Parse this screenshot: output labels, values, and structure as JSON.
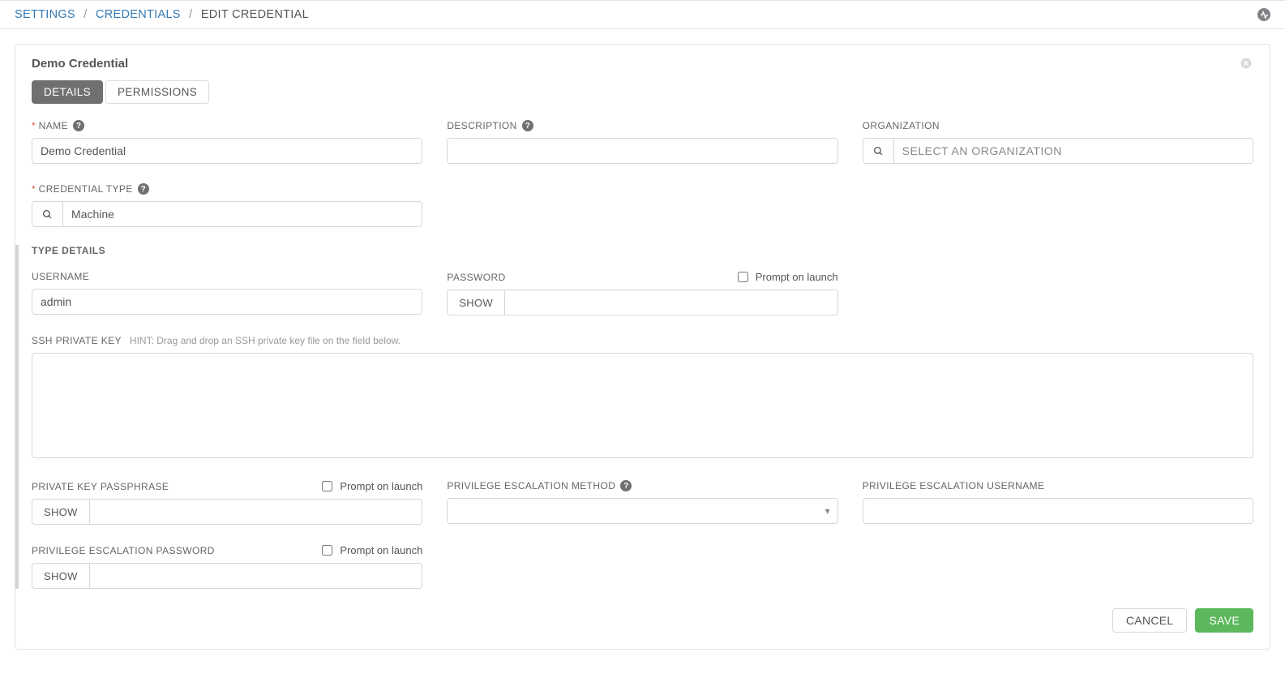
{
  "breadcrumb": {
    "settings": "SETTINGS",
    "credentials": "CREDENTIALS",
    "current": "EDIT CREDENTIAL"
  },
  "panel": {
    "title": "Demo Credential"
  },
  "tabs": {
    "details": "DETAILS",
    "permissions": "PERMISSIONS"
  },
  "fields": {
    "name": {
      "label": "NAME",
      "value": "Demo Credential"
    },
    "description": {
      "label": "DESCRIPTION",
      "value": ""
    },
    "organization": {
      "label": "ORGANIZATION",
      "placeholder": "SELECT AN ORGANIZATION",
      "value": ""
    },
    "credential_type": {
      "label": "CREDENTIAL TYPE",
      "value": "Machine"
    },
    "type_details_header": "TYPE DETAILS",
    "username": {
      "label": "USERNAME",
      "value": "admin"
    },
    "password": {
      "label": "PASSWORD",
      "value": "",
      "show": "SHOW",
      "prompt_label": "Prompt on launch"
    },
    "ssh_private_key": {
      "label": "SSH PRIVATE KEY",
      "hint": "HINT: Drag and drop an SSH private key file on the field below.",
      "value": ""
    },
    "private_key_passphrase": {
      "label": "PRIVATE KEY PASSPHRASE",
      "value": "",
      "show": "SHOW",
      "prompt_label": "Prompt on launch"
    },
    "priv_esc_method": {
      "label": "PRIVILEGE ESCALATION METHOD",
      "value": ""
    },
    "priv_esc_username": {
      "label": "PRIVILEGE ESCALATION USERNAME",
      "value": ""
    },
    "priv_esc_password": {
      "label": "PRIVILEGE ESCALATION PASSWORD",
      "value": "",
      "show": "SHOW",
      "prompt_label": "Prompt on launch"
    }
  },
  "buttons": {
    "cancel": "CANCEL",
    "save": "SAVE"
  }
}
